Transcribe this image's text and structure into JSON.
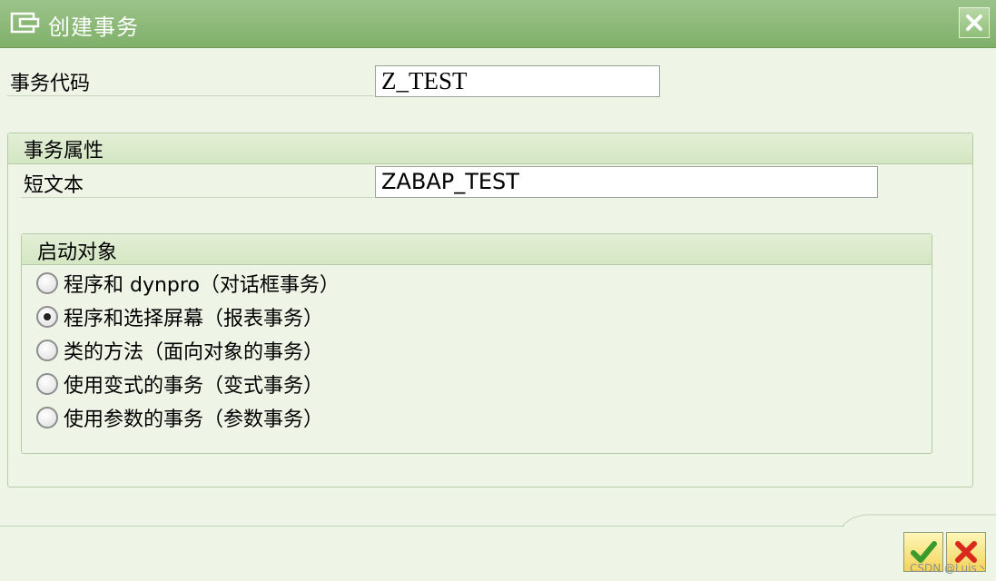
{
  "window": {
    "title": "创建事务",
    "icon": "create-transaction-icon",
    "close_icon": "close-icon"
  },
  "transaction": {
    "code_label": "事务代码",
    "code_value": "Z_TEST"
  },
  "attributes": {
    "title": "事务属性",
    "short_text_label": "短文本",
    "short_text_value": "ZABAP_TEST"
  },
  "start_object": {
    "title": "启动对象",
    "options": [
      {
        "label": "程序和 dynpro（对话框事务）",
        "checked": false
      },
      {
        "label": "程序和选择屏幕（报表事务）",
        "checked": true
      },
      {
        "label": "类的方法（面向对象的事务）",
        "checked": false
      },
      {
        "label": "使用变式的事务（变式事务）",
        "checked": false
      },
      {
        "label": "使用参数的事务（参数事务）",
        "checked": false
      }
    ]
  },
  "footer": {
    "confirm_icon": "checkmark-icon",
    "cancel_icon": "cancel-icon",
    "watermark": "CSDN @Luis丶"
  },
  "colors": {
    "titlebar": "#88b874",
    "background": "#eef5e6",
    "button_yellow": "#f4d45a",
    "confirm_green": "#3a9a2c",
    "cancel_red": "#d9281c"
  }
}
